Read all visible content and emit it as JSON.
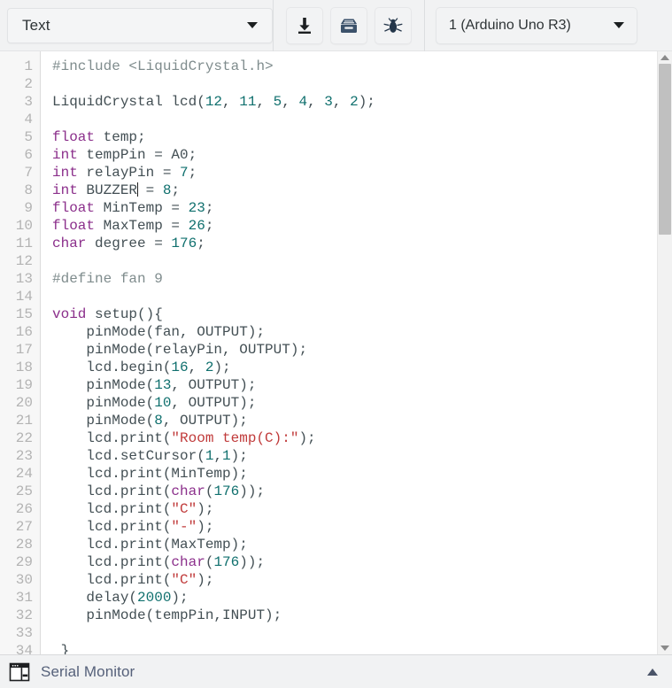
{
  "toolbar": {
    "type_select": {
      "value": "Text",
      "icon": "chevron-down-icon"
    },
    "buttons": [
      {
        "name": "upload-button",
        "icon": "download-arrow-icon",
        "label": ""
      },
      {
        "name": "library-button",
        "icon": "archive-box-icon",
        "label": ""
      },
      {
        "name": "debug-button",
        "icon": "bug-icon",
        "label": ""
      }
    ],
    "board_select": {
      "value": "1 (Arduino Uno R3)",
      "icon": "chevron-down-icon"
    }
  },
  "editor": {
    "first_visible_line": 1,
    "last_visible_line": 34,
    "line_numbers": [
      "1",
      "2",
      "3",
      "4",
      "5",
      "6",
      "7",
      "8",
      "9",
      "10",
      "11",
      "12",
      "13",
      "14",
      "15",
      "16",
      "17",
      "18",
      "19",
      "20",
      "21",
      "22",
      "23",
      "24",
      "25",
      "26",
      "27",
      "28",
      "29",
      "30",
      "31",
      "32",
      "33",
      "34"
    ],
    "cursor_line": 8,
    "lines": [
      {
        "n": 1,
        "tokens": [
          {
            "t": "pre",
            "v": "#include <LiquidCrystal.h>"
          }
        ]
      },
      {
        "n": 2,
        "tokens": []
      },
      {
        "n": 3,
        "tokens": [
          {
            "t": "pln",
            "v": "LiquidCrystal lcd("
          },
          {
            "t": "num",
            "v": "12"
          },
          {
            "t": "pln",
            "v": ", "
          },
          {
            "t": "num",
            "v": "11"
          },
          {
            "t": "pln",
            "v": ", "
          },
          {
            "t": "num",
            "v": "5"
          },
          {
            "t": "pln",
            "v": ", "
          },
          {
            "t": "num",
            "v": "4"
          },
          {
            "t": "pln",
            "v": ", "
          },
          {
            "t": "num",
            "v": "3"
          },
          {
            "t": "pln",
            "v": ", "
          },
          {
            "t": "num",
            "v": "2"
          },
          {
            "t": "pln",
            "v": ");"
          }
        ]
      },
      {
        "n": 4,
        "tokens": []
      },
      {
        "n": 5,
        "tokens": [
          {
            "t": "k",
            "v": "float"
          },
          {
            "t": "pln",
            "v": " temp;"
          }
        ]
      },
      {
        "n": 6,
        "tokens": [
          {
            "t": "k",
            "v": "int"
          },
          {
            "t": "pln",
            "v": " tempPin = A0;"
          }
        ]
      },
      {
        "n": 7,
        "tokens": [
          {
            "t": "k",
            "v": "int"
          },
          {
            "t": "pln",
            "v": " relayPin = "
          },
          {
            "t": "num",
            "v": "7"
          },
          {
            "t": "pln",
            "v": ";"
          }
        ]
      },
      {
        "n": 8,
        "tokens": [
          {
            "t": "k",
            "v": "int"
          },
          {
            "t": "pln",
            "v": " BUZZER"
          },
          {
            "t": "caret",
            "v": ""
          },
          {
            "t": "pln",
            "v": " = "
          },
          {
            "t": "num",
            "v": "8"
          },
          {
            "t": "pln",
            "v": ";"
          }
        ]
      },
      {
        "n": 9,
        "tokens": [
          {
            "t": "k",
            "v": "float"
          },
          {
            "t": "pln",
            "v": " MinTemp = "
          },
          {
            "t": "num",
            "v": "23"
          },
          {
            "t": "pln",
            "v": ";"
          }
        ]
      },
      {
        "n": 10,
        "tokens": [
          {
            "t": "k",
            "v": "float"
          },
          {
            "t": "pln",
            "v": " MaxTemp = "
          },
          {
            "t": "num",
            "v": "26"
          },
          {
            "t": "pln",
            "v": ";"
          }
        ]
      },
      {
        "n": 11,
        "tokens": [
          {
            "t": "k",
            "v": "char"
          },
          {
            "t": "pln",
            "v": " degree = "
          },
          {
            "t": "num",
            "v": "176"
          },
          {
            "t": "pln",
            "v": ";"
          }
        ]
      },
      {
        "n": 12,
        "tokens": []
      },
      {
        "n": 13,
        "tokens": [
          {
            "t": "pre",
            "v": "#define fan 9"
          }
        ]
      },
      {
        "n": 14,
        "tokens": []
      },
      {
        "n": 15,
        "tokens": [
          {
            "t": "k",
            "v": "void"
          },
          {
            "t": "pln",
            "v": " setup(){"
          }
        ]
      },
      {
        "n": 16,
        "tokens": [
          {
            "t": "pln",
            "v": "    pinMode(fan, OUTPUT);"
          }
        ]
      },
      {
        "n": 17,
        "tokens": [
          {
            "t": "pln",
            "v": "    pinMode(relayPin, OUTPUT);"
          }
        ]
      },
      {
        "n": 18,
        "tokens": [
          {
            "t": "pln",
            "v": "    lcd.begin("
          },
          {
            "t": "num",
            "v": "16"
          },
          {
            "t": "pln",
            "v": ", "
          },
          {
            "t": "num",
            "v": "2"
          },
          {
            "t": "pln",
            "v": ");"
          }
        ]
      },
      {
        "n": 19,
        "tokens": [
          {
            "t": "pln",
            "v": "    pinMode("
          },
          {
            "t": "num",
            "v": "13"
          },
          {
            "t": "pln",
            "v": ", OUTPUT);"
          }
        ]
      },
      {
        "n": 20,
        "tokens": [
          {
            "t": "pln",
            "v": "    pinMode("
          },
          {
            "t": "num",
            "v": "10"
          },
          {
            "t": "pln",
            "v": ", OUTPUT);"
          }
        ]
      },
      {
        "n": 21,
        "tokens": [
          {
            "t": "pln",
            "v": "    pinMode("
          },
          {
            "t": "num",
            "v": "8"
          },
          {
            "t": "pln",
            "v": ", OUTPUT);"
          }
        ]
      },
      {
        "n": 22,
        "tokens": [
          {
            "t": "pln",
            "v": "    lcd.print("
          },
          {
            "t": "str",
            "v": "\"Room temp(C):\""
          },
          {
            "t": "pln",
            "v": ");"
          }
        ]
      },
      {
        "n": 23,
        "tokens": [
          {
            "t": "pln",
            "v": "    lcd.setCursor("
          },
          {
            "t": "num",
            "v": "1"
          },
          {
            "t": "pln",
            "v": ","
          },
          {
            "t": "num",
            "v": "1"
          },
          {
            "t": "pln",
            "v": ");"
          }
        ]
      },
      {
        "n": 24,
        "tokens": [
          {
            "t": "pln",
            "v": "    lcd.print(MinTemp);"
          }
        ]
      },
      {
        "n": 25,
        "tokens": [
          {
            "t": "pln",
            "v": "    lcd.print("
          },
          {
            "t": "k",
            "v": "char"
          },
          {
            "t": "pln",
            "v": "("
          },
          {
            "t": "num",
            "v": "176"
          },
          {
            "t": "pln",
            "v": "));"
          }
        ]
      },
      {
        "n": 26,
        "tokens": [
          {
            "t": "pln",
            "v": "    lcd.print("
          },
          {
            "t": "str",
            "v": "\"C\""
          },
          {
            "t": "pln",
            "v": ");"
          }
        ]
      },
      {
        "n": 27,
        "tokens": [
          {
            "t": "pln",
            "v": "    lcd.print("
          },
          {
            "t": "str",
            "v": "\"-\""
          },
          {
            "t": "pln",
            "v": ");"
          }
        ]
      },
      {
        "n": 28,
        "tokens": [
          {
            "t": "pln",
            "v": "    lcd.print(MaxTemp);"
          }
        ]
      },
      {
        "n": 29,
        "tokens": [
          {
            "t": "pln",
            "v": "    lcd.print("
          },
          {
            "t": "k",
            "v": "char"
          },
          {
            "t": "pln",
            "v": "("
          },
          {
            "t": "num",
            "v": "176"
          },
          {
            "t": "pln",
            "v": "));"
          }
        ]
      },
      {
        "n": 30,
        "tokens": [
          {
            "t": "pln",
            "v": "    lcd.print("
          },
          {
            "t": "str",
            "v": "\"C\""
          },
          {
            "t": "pln",
            "v": ");"
          }
        ]
      },
      {
        "n": 31,
        "tokens": [
          {
            "t": "pln",
            "v": "    delay("
          },
          {
            "t": "num",
            "v": "2000"
          },
          {
            "t": "pln",
            "v": ");"
          }
        ]
      },
      {
        "n": 32,
        "tokens": [
          {
            "t": "pln",
            "v": "    pinMode(tempPin,INPUT);"
          }
        ]
      },
      {
        "n": 33,
        "tokens": []
      },
      {
        "n": 34,
        "tokens": [
          {
            "t": "pln",
            "v": " }"
          }
        ]
      }
    ]
  },
  "scrollbar": {
    "up_icon": "triangle-up-icon",
    "down_icon": "triangle-down-icon"
  },
  "serial_monitor": {
    "label": "Serial Monitor",
    "icon": "serial-monitor-window-icon",
    "expand_icon": "triangle-up-icon"
  },
  "colors": {
    "keyword": "#8b2f8b",
    "number": "#10706e",
    "string": "#c03a3a",
    "preprocessor": "#7f8c8d",
    "plain": "#434f54",
    "toolbar_bg": "#f1f2f3",
    "gutter_bg": "#f7f7f7",
    "serial_label": "#56617a",
    "icon_dark": "#2e4257"
  }
}
